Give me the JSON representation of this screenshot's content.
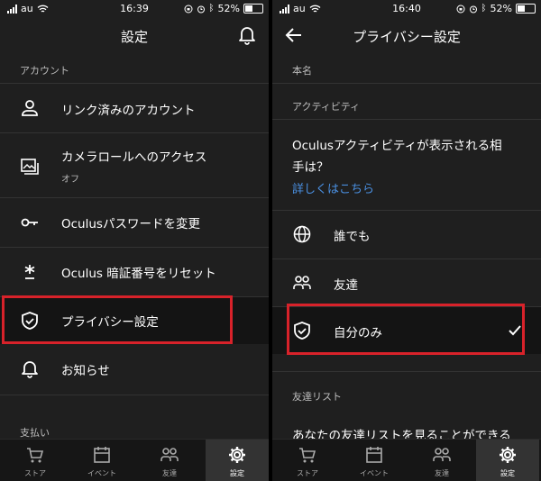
{
  "status_left": {
    "carrier": "au",
    "time": "16:39",
    "battery": "52%"
  },
  "status_right": {
    "carrier": "au",
    "time": "16:40",
    "battery": "52%"
  },
  "left": {
    "title": "設定",
    "section_account": "アカウント",
    "items": [
      {
        "label": "リンク済みのアカウント",
        "icon": "person-icon"
      },
      {
        "label": "カメラロールへのアクセス",
        "sub": "オフ",
        "icon": "photos-icon"
      },
      {
        "label": "Oculusパスワードを変更",
        "icon": "key-icon"
      },
      {
        "label": "Oculus 暗証番号をリセット",
        "icon": "asterisk-icon"
      },
      {
        "label": "プライバシー設定",
        "icon": "shield-icon"
      },
      {
        "label": "お知らせ",
        "icon": "bell-icon"
      }
    ],
    "section_payment": "支払い"
  },
  "right": {
    "title": "プライバシー設定",
    "section_name": "本名",
    "section_activity": "アクティビティ",
    "question_line1": "Oculusアクティビティが表示される相",
    "question_line2": "手は？",
    "link": "詳しくはこちら",
    "options": [
      {
        "label": "誰でも",
        "icon": "globe-icon"
      },
      {
        "label": "友達",
        "icon": "friends-icon"
      },
      {
        "label": "自分のみ",
        "icon": "shield-icon",
        "selected": true
      }
    ],
    "section_friends": "友達リスト",
    "friends_text": "あなたの友達リストを見ることができる"
  },
  "tabs": [
    {
      "label": "ストア",
      "icon": "cart-icon"
    },
    {
      "label": "イベント",
      "icon": "calendar-icon"
    },
    {
      "label": "友達",
      "icon": "friends-icon"
    },
    {
      "label": "設定",
      "icon": "gear-icon",
      "active": true
    }
  ],
  "colors": {
    "background": "#1f1f1f",
    "highlight": "#d8222a",
    "link": "#4a90e2"
  }
}
